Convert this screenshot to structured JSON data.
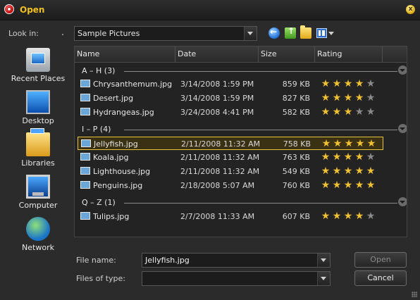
{
  "window": {
    "title": "Open",
    "close_glyph": "x"
  },
  "toolbar": {
    "lookin_label": "Look in:",
    "lookin_value": "Sample Pictures",
    "icons": [
      "back-icon",
      "up-folder-icon",
      "new-folder-icon",
      "views-icon"
    ]
  },
  "places": [
    {
      "label": "Recent Places",
      "icon": "recent-places-icon"
    },
    {
      "label": "Desktop",
      "icon": "desktop-icon"
    },
    {
      "label": "Libraries",
      "icon": "libraries-icon"
    },
    {
      "label": "Computer",
      "icon": "computer-icon"
    },
    {
      "label": "Network",
      "icon": "network-icon"
    }
  ],
  "columns": {
    "name": "Name",
    "date": "Date",
    "size": "Size",
    "rating": "Rating"
  },
  "groups": [
    {
      "label": "A – H (3)",
      "files": [
        {
          "name": "Chrysanthemum.jpg",
          "date": "3/14/2008 1:59 PM",
          "size": "859 KB",
          "rating": 4
        },
        {
          "name": "Desert.jpg",
          "date": "3/14/2008 1:59 PM",
          "size": "827 KB",
          "rating": 4
        },
        {
          "name": "Hydrangeas.jpg",
          "date": "3/24/2008 4:41 PM",
          "size": "582 KB",
          "rating": 3
        }
      ]
    },
    {
      "label": "I – P (4)",
      "files": [
        {
          "name": "Jellyfish.jpg",
          "date": "2/11/2008 11:32 AM",
          "size": "758 KB",
          "rating": 5,
          "selected": true
        },
        {
          "name": "Koala.jpg",
          "date": "2/11/2008 11:32 AM",
          "size": "763 KB",
          "rating": 4
        },
        {
          "name": "Lighthouse.jpg",
          "date": "2/11/2008 11:32 AM",
          "size": "549 KB",
          "rating": 5
        },
        {
          "name": "Penguins.jpg",
          "date": "2/18/2008 5:07 AM",
          "size": "760 KB",
          "rating": 5
        }
      ]
    },
    {
      "label": "Q – Z (1)",
      "files": [
        {
          "name": "Tulips.jpg",
          "date": "2/7/2008 11:33 AM",
          "size": "607 KB",
          "rating": 4
        }
      ]
    }
  ],
  "footer": {
    "filename_label": "File name:",
    "filename_value": "Jellyfish.jpg",
    "filetype_label": "Files of type:",
    "filetype_value": "",
    "open_label": "Open",
    "cancel_label": "Cancel"
  },
  "colors": {
    "accent": "#f0c020",
    "selection_border": "#e8c43c",
    "star_on": "#f0c030",
    "star_off": "#8a8a8a"
  }
}
